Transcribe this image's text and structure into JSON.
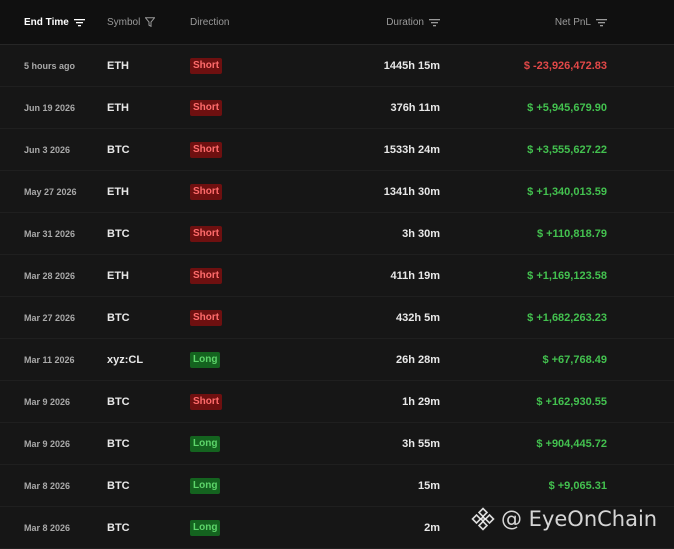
{
  "header": {
    "end_time": "End Time",
    "symbol": "Symbol",
    "direction": "Direction",
    "duration": "Duration",
    "net_pnl": "Net PnL"
  },
  "rows": [
    {
      "time": "5 hours ago",
      "symbol": "ETH",
      "direction": "Short",
      "duration": "1445h 15m",
      "pnl": "$ -23,926,472.83",
      "pnl_sign": "neg"
    },
    {
      "time": "Jun 19 2026",
      "symbol": "ETH",
      "direction": "Short",
      "duration": "376h 11m",
      "pnl": "$ +5,945,679.90",
      "pnl_sign": "pos"
    },
    {
      "time": "Jun 3 2026",
      "symbol": "BTC",
      "direction": "Short",
      "duration": "1533h 24m",
      "pnl": "$ +3,555,627.22",
      "pnl_sign": "pos"
    },
    {
      "time": "May 27 2026",
      "symbol": "ETH",
      "direction": "Short",
      "duration": "1341h 30m",
      "pnl": "$ +1,340,013.59",
      "pnl_sign": "pos"
    },
    {
      "time": "Mar 31 2026",
      "symbol": "BTC",
      "direction": "Short",
      "duration": "3h 30m",
      "pnl": "$ +110,818.79",
      "pnl_sign": "pos"
    },
    {
      "time": "Mar 28 2026",
      "symbol": "ETH",
      "direction": "Short",
      "duration": "411h 19m",
      "pnl": "$ +1,169,123.58",
      "pnl_sign": "pos"
    },
    {
      "time": "Mar 27 2026",
      "symbol": "BTC",
      "direction": "Short",
      "duration": "432h 5m",
      "pnl": "$ +1,682,263.23",
      "pnl_sign": "pos"
    },
    {
      "time": "Mar 11 2026",
      "symbol": "xyz:CL",
      "direction": "Long",
      "duration": "26h 28m",
      "pnl": "$ +67,768.49",
      "pnl_sign": "pos"
    },
    {
      "time": "Mar 9 2026",
      "symbol": "BTC",
      "direction": "Short",
      "duration": "1h 29m",
      "pnl": "$ +162,930.55",
      "pnl_sign": "pos"
    },
    {
      "time": "Mar 9 2026",
      "symbol": "BTC",
      "direction": "Long",
      "duration": "3h 55m",
      "pnl": "$ +904,445.72",
      "pnl_sign": "pos"
    },
    {
      "time": "Mar 8 2026",
      "symbol": "BTC",
      "direction": "Long",
      "duration": "15m",
      "pnl": "$ +9,065.31",
      "pnl_sign": "pos"
    },
    {
      "time": "Mar 8 2026",
      "symbol": "BTC",
      "direction": "Long",
      "duration": "2m",
      "pnl": "",
      "pnl_sign": "pos"
    }
  ],
  "watermark": {
    "text": "@ EyeOnChain",
    "icon": "binance-logo-icon"
  },
  "colors": {
    "short_bg": "#6e1010",
    "short_text": "#ff6b6b",
    "long_bg": "#14631f",
    "long_text": "#5dd56a",
    "pnl_pos": "#43c14f",
    "pnl_neg": "#e24848"
  }
}
